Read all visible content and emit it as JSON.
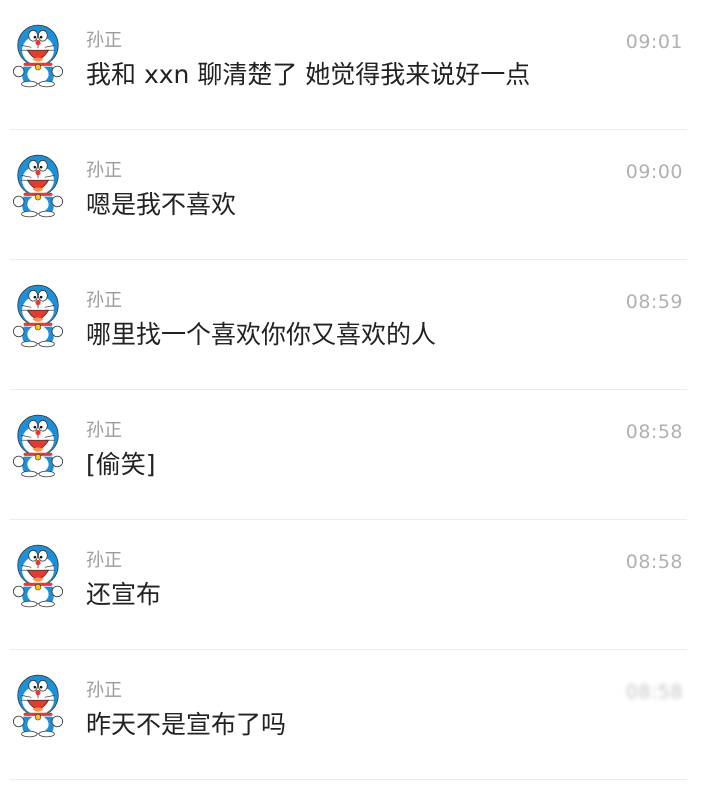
{
  "avatar_icon": "doraemon-avatar-icon",
  "colors": {
    "name": "#9a9a9a",
    "time": "#b1b1b1",
    "message": "#222222",
    "divider": "#ececec",
    "avatar_blue": "#1f8fd8"
  },
  "messages": [
    {
      "sender": "孙正",
      "time": "09:01",
      "text": "我和 xxn 聊清楚了 她觉得我来说好一点"
    },
    {
      "sender": "孙正",
      "time": "09:00",
      "text": "嗯是我不喜欢"
    },
    {
      "sender": "孙正",
      "time": "08:59",
      "text": "哪里找一个喜欢你你又喜欢的人"
    },
    {
      "sender": "孙正",
      "time": "08:58",
      "text": "[偷笑]"
    },
    {
      "sender": "孙正",
      "time": "08:58",
      "text": "还宣布"
    },
    {
      "sender": "孙正",
      "time": "08:58",
      "text": "昨天不是宣布了吗"
    }
  ]
}
